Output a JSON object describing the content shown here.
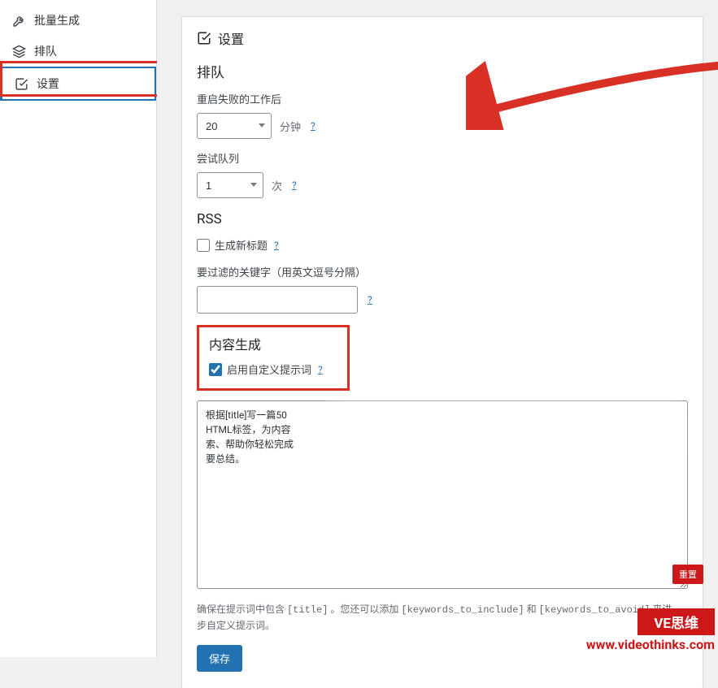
{
  "sidebar": {
    "items": [
      {
        "label": "批量生成"
      },
      {
        "label": "排队"
      },
      {
        "label": "设置"
      }
    ]
  },
  "panel": {
    "title": "设置"
  },
  "queue": {
    "heading": "排队",
    "restart_label": "重启失败的工作后",
    "restart_value": "20",
    "restart_unit": "分钟",
    "attempts_label": "尝试队列",
    "attempts_value": "1",
    "attempts_unit": "次",
    "help": "?"
  },
  "rss": {
    "heading": "RSS",
    "new_title_label": "生成新标题",
    "filter_label": "要过滤的关键字（用英文逗号分隔）",
    "filter_value": "",
    "help": "?"
  },
  "content": {
    "heading": "内容生成",
    "enable_label": "启用自定义提示词",
    "prompt_value": "根据[title]写一篇50\nHTML标签，为内容\n索、帮助你轻松完成\n要总结。",
    "hint_prefix": "确保在提示词中包含 ",
    "hint_title": "[title]",
    "hint_mid": " 。您还可以添加 ",
    "hint_inc": "[keywords_to_include]",
    "hint_and": " 和 ",
    "hint_avoid": "[keywords_to_avoid]",
    "hint_suffix": " 来进一步自定义提示词。",
    "help": "?"
  },
  "buttons": {
    "save": "保存",
    "reset": "重置"
  },
  "watermark": {
    "tag": "VE思维",
    "url": "www.videothinks.com"
  }
}
